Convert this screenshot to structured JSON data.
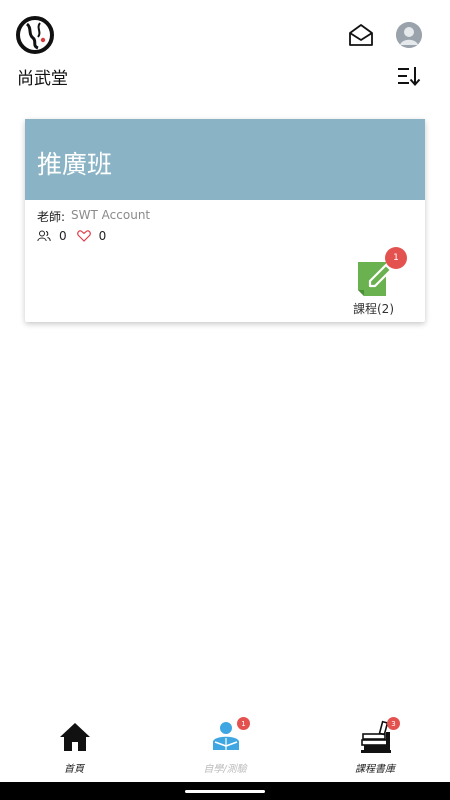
{
  "header": {
    "site_title": "尚武堂",
    "logo_icon": "brand-logo-icon",
    "mail_icon": "envelope-open-icon",
    "avatar_icon": "user-avatar-icon",
    "sort_icon": "sort-descending-icon"
  },
  "card": {
    "title": "推廣班",
    "header_color": "#8ab4c5",
    "teacher_label": "老師:",
    "teacher_name": "SWT Account",
    "members_count": "0",
    "likes_count": "0",
    "members_icon": "people-icon",
    "likes_icon": "heart-outline-icon",
    "course_badge": "1",
    "course_label": "課程(2)",
    "course_icon": "edit-note-icon",
    "course_color": "#6ab150"
  },
  "bottom_nav": {
    "items": [
      {
        "label": "首頁",
        "icon": "home-icon",
        "badge": ""
      },
      {
        "label": "自學/測驗",
        "icon": "reading-person-icon",
        "badge": "1"
      },
      {
        "label": "課程書庫",
        "icon": "bookshelf-icon",
        "badge": "3"
      }
    ]
  },
  "colors": {
    "badge": "#e4524f",
    "accent_blue": "#3ea6e0"
  }
}
